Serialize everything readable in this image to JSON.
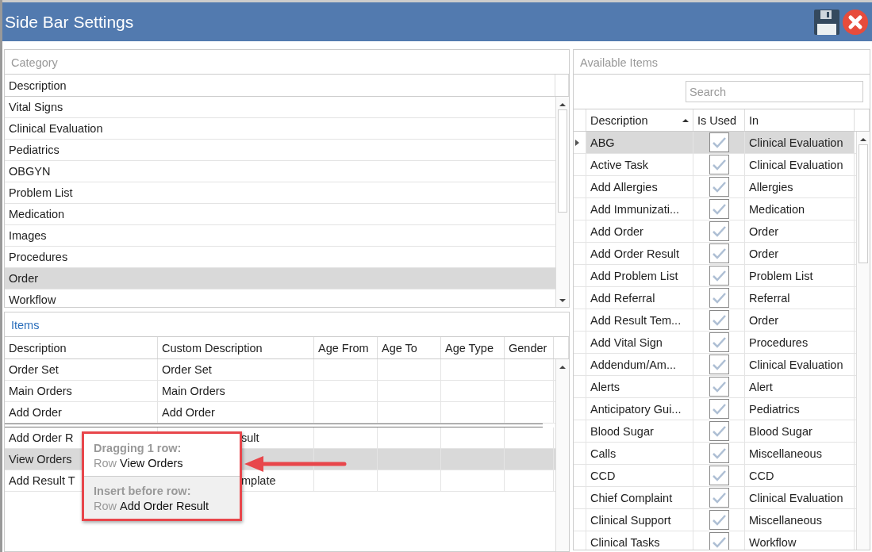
{
  "window": {
    "title": "Side Bar Settings"
  },
  "category": {
    "title": "Category",
    "column": "Description",
    "rows": [
      {
        "description": "Vital Signs",
        "selected": false
      },
      {
        "description": "Clinical Evaluation",
        "selected": false
      },
      {
        "description": "Pediatrics",
        "selected": false
      },
      {
        "description": "OBGYN",
        "selected": false
      },
      {
        "description": "Problem List",
        "selected": false
      },
      {
        "description": "Medication",
        "selected": false
      },
      {
        "description": "Images",
        "selected": false
      },
      {
        "description": "Procedures",
        "selected": false
      },
      {
        "description": "Order",
        "selected": true
      },
      {
        "description": "Workflow",
        "selected": false
      }
    ]
  },
  "items": {
    "title": "Items",
    "columns": [
      "Description",
      "Custom Description",
      "Age From",
      "Age To",
      "Age Type",
      "Gender"
    ],
    "rows": [
      {
        "kind": "row",
        "description": "Order Set",
        "custom_description": "Order Set",
        "selected": false,
        "covered": false
      },
      {
        "kind": "row",
        "description": "Main Orders",
        "custom_description": "Main Orders",
        "selected": false,
        "covered": false
      },
      {
        "kind": "row",
        "description": "Add Order",
        "custom_description": "Add Order",
        "selected": false,
        "covered": false
      },
      {
        "kind": "insert_marker"
      },
      {
        "kind": "row",
        "description": "Add Order R",
        "custom_description": "sult",
        "selected": false,
        "covered": true
      },
      {
        "kind": "row",
        "description": "View Orders",
        "selected": true,
        "covered": true
      },
      {
        "kind": "row",
        "description": "Add Result T",
        "custom_description": "mplate",
        "selected": false,
        "covered": true
      }
    ]
  },
  "drag_tooltip": {
    "heading": "Dragging 1 row:",
    "row_prefix": "Row",
    "row": "View Orders",
    "target_heading": "Insert before row:",
    "target_prefix": "Row",
    "target_row": "Add Order Result"
  },
  "available": {
    "title": "Available Items",
    "search": {
      "placeholder": "Search"
    },
    "columns": [
      {
        "label": "Description",
        "sorted": true
      },
      {
        "label": "Is Used",
        "sorted": false
      },
      {
        "label": "In",
        "sorted": false
      }
    ],
    "rows": [
      {
        "description": "ABG",
        "used": true,
        "in": "Clinical Evaluation",
        "selected": true
      },
      {
        "description": "Active Task",
        "used": true,
        "in": "Clinical Evaluation",
        "selected": false
      },
      {
        "description": "Add Allergies",
        "used": true,
        "in": "Allergies",
        "selected": false
      },
      {
        "description": "Add Immunizati...",
        "used": true,
        "in": "Medication",
        "selected": false
      },
      {
        "description": "Add Order",
        "used": true,
        "in": "Order",
        "selected": false
      },
      {
        "description": "Add Order Result",
        "used": true,
        "in": "Order",
        "selected": false
      },
      {
        "description": "Add Problem List",
        "used": true,
        "in": "Problem List",
        "selected": false
      },
      {
        "description": "Add Referral",
        "used": true,
        "in": "Referral",
        "selected": false
      },
      {
        "description": "Add Result Tem...",
        "used": true,
        "in": "Order",
        "selected": false
      },
      {
        "description": "Add Vital Sign",
        "used": true,
        "in": "Procedures",
        "selected": false
      },
      {
        "description": "Addendum/Am...",
        "used": true,
        "in": "Clinical Evaluation",
        "selected": false
      },
      {
        "description": "Alerts",
        "used": true,
        "in": "Alert",
        "selected": false
      },
      {
        "description": "Anticipatory Gui...",
        "used": true,
        "in": "Pediatrics",
        "selected": false
      },
      {
        "description": "Blood Sugar",
        "used": true,
        "in": "Blood Sugar",
        "selected": false
      },
      {
        "description": "Calls",
        "used": true,
        "in": "Miscellaneous",
        "selected": false
      },
      {
        "description": "CCD",
        "used": true,
        "in": "CCD",
        "selected": false
      },
      {
        "description": "Chief Complaint",
        "used": true,
        "in": "Clinical Evaluation",
        "selected": false
      },
      {
        "description": "Clinical Support",
        "used": true,
        "in": "Miscellaneous",
        "selected": false
      },
      {
        "description": "Clinical Tasks",
        "used": true,
        "in": "Workflow",
        "selected": false
      }
    ]
  }
}
